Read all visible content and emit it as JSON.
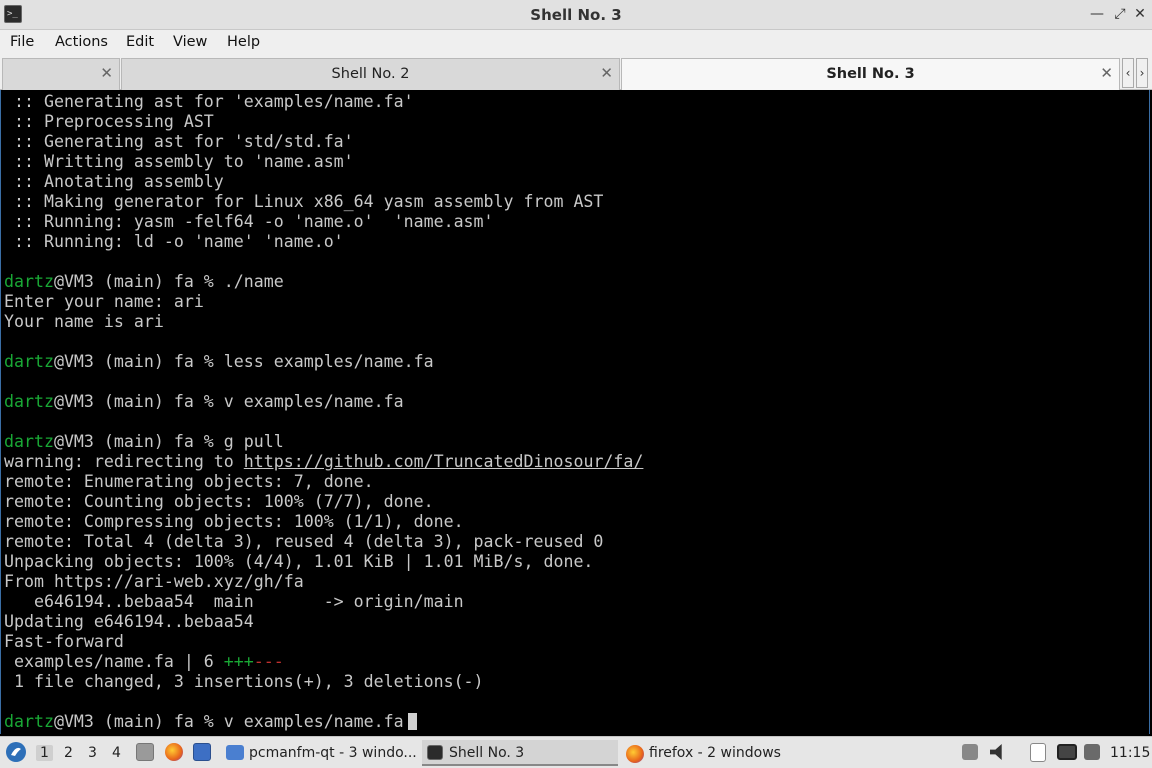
{
  "window": {
    "title": "Shell No. 3",
    "app_icon": "terminal-icon",
    "controls": [
      "minimize-icon",
      "maximize-icon",
      "close-icon"
    ]
  },
  "menu": [
    "File",
    "Actions",
    "Edit",
    "View",
    "Help"
  ],
  "tabs": [
    {
      "label": "",
      "active": false
    },
    {
      "label": "Shell No. 2",
      "active": false
    },
    {
      "label": "Shell No. 3",
      "active": true
    }
  ],
  "tab_scroll": {
    "left": "‹",
    "right": "›"
  },
  "terminal": {
    "lines": [
      [
        {
          "t": " :: Generating ast for 'examples/name.fa'"
        }
      ],
      [
        {
          "t": " :: Preprocessing AST"
        }
      ],
      [
        {
          "t": " :: Generating ast for 'std/std.fa'"
        }
      ],
      [
        {
          "t": " :: Writting assembly to 'name.asm'"
        }
      ],
      [
        {
          "t": " :: Anotating assembly"
        }
      ],
      [
        {
          "t": " :: Making generator for Linux x86_64 yasm assembly from AST"
        }
      ],
      [
        {
          "t": " :: Running: yasm -felf64 -o 'name.o'  'name.asm'"
        }
      ],
      [
        {
          "t": " :: Running: ld -o 'name' 'name.o'"
        }
      ],
      [
        {
          "t": ""
        }
      ],
      [
        {
          "t": "dartz",
          "c": "user"
        },
        {
          "t": "@VM3 (main) fa % ./name"
        }
      ],
      [
        {
          "t": "Enter your name: ari"
        }
      ],
      [
        {
          "t": "Your name is ari"
        }
      ],
      [
        {
          "t": ""
        }
      ],
      [
        {
          "t": "dartz",
          "c": "user"
        },
        {
          "t": "@VM3 (main) fa % less examples/name.fa"
        }
      ],
      [
        {
          "t": ""
        }
      ],
      [
        {
          "t": "dartz",
          "c": "user"
        },
        {
          "t": "@VM3 (main) fa % v examples/name.fa"
        }
      ],
      [
        {
          "t": ""
        }
      ],
      [
        {
          "t": "dartz",
          "c": "user"
        },
        {
          "t": "@VM3 (main) fa % g pull"
        }
      ],
      [
        {
          "t": "warning: redirecting to "
        },
        {
          "t": "https://github.com/TruncatedDinosour/fa/",
          "c": "url"
        }
      ],
      [
        {
          "t": "remote: Enumerating objects: 7, done."
        }
      ],
      [
        {
          "t": "remote: Counting objects: 100% (7/7), done."
        }
      ],
      [
        {
          "t": "remote: Compressing objects: 100% (1/1), done."
        }
      ],
      [
        {
          "t": "remote: Total 4 (delta 3), reused 4 (delta 3), pack-reused 0"
        }
      ],
      [
        {
          "t": "Unpacking objects: 100% (4/4), 1.01 KiB | 1.01 MiB/s, done."
        }
      ],
      [
        {
          "t": "From https://ari-web.xyz/gh/fa"
        }
      ],
      [
        {
          "t": "   e646194..bebaa54  main       -> origin/main"
        }
      ],
      [
        {
          "t": "Updating e646194..bebaa54"
        }
      ],
      [
        {
          "t": "Fast-forward"
        }
      ],
      [
        {
          "t": " examples/name.fa | 6 "
        },
        {
          "t": "+++",
          "c": "ins"
        },
        {
          "t": "---",
          "c": "del"
        }
      ],
      [
        {
          "t": " 1 file changed, 3 insertions(+), 3 deletions(-)"
        }
      ],
      [
        {
          "t": ""
        }
      ],
      [
        {
          "t": "dartz",
          "c": "user"
        },
        {
          "t": "@VM3 (main) fa % v examples/name.fa"
        },
        {
          "t": "",
          "c": "cursor"
        }
      ]
    ]
  },
  "taskbar": {
    "start_icon": "start-menu-icon",
    "workspaces": [
      "1",
      "2",
      "3",
      "4"
    ],
    "active_workspace": "1",
    "quicklaunch": [
      "file-manager-icon",
      "firefox-icon",
      "desktop-icon"
    ],
    "tasks": [
      {
        "label": "pcmanfm-qt - 3 windo...",
        "icon": "folder-icon",
        "active": false
      },
      {
        "label": "Shell No. 3",
        "icon": "terminal-icon",
        "active": true
      },
      {
        "label": "firefox - 2 windows",
        "icon": "firefox-icon",
        "active": false
      }
    ],
    "tray": [
      "eject-icon",
      "volume-icon",
      "clipboard-icon",
      "network-icon",
      "notes-icon"
    ],
    "clock": "11:15"
  }
}
